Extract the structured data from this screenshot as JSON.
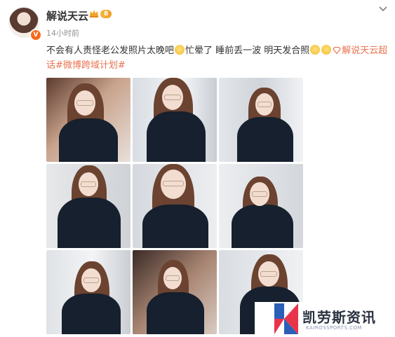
{
  "post": {
    "user": {
      "name": "解说天云",
      "vip_level": "8",
      "verified_mark": "V"
    },
    "time": "14小时前",
    "content": {
      "text1": "不会有人责怪老公发照片太晚吧",
      "text2": "忙晕了 睡前丢一波 明天发合照",
      "tag1": "解说天云超话",
      "tag2": "#微博跨域计划#"
    },
    "photo_count": 9
  },
  "watermark": {
    "title": "凯劳斯资讯",
    "subtitle": "KAIROSSPORTS.COM",
    "colors": {
      "red": "#e8344a",
      "blue": "#2b5fb8"
    }
  },
  "colors": {
    "tag": "#eb7350",
    "text": "#333333",
    "muted": "#939393"
  }
}
